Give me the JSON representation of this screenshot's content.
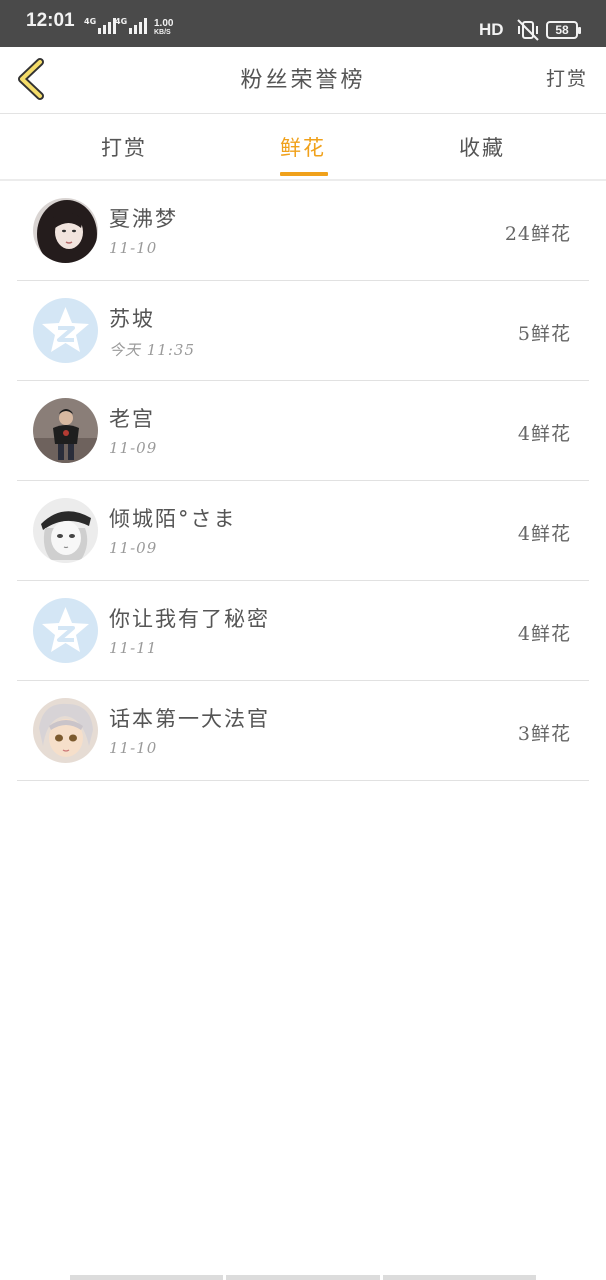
{
  "status_bar": {
    "time": "12:01",
    "net1_label": "4G",
    "net2_label": "4G",
    "speed_value": "1.00",
    "speed_unit": "KB/S",
    "hd_label": "HD",
    "battery": "58",
    "icons": [
      "signal-icon",
      "vibrate-mute-icon",
      "battery-icon"
    ]
  },
  "header": {
    "title": "粉丝荣誉榜",
    "action": "打赏",
    "back_icon": "chevron-left-icon"
  },
  "tabs": [
    {
      "label": "打赏",
      "active": false
    },
    {
      "label": "鲜花",
      "active": true
    },
    {
      "label": "收藏",
      "active": false
    }
  ],
  "accent_color": "#f0a11b",
  "fans": [
    {
      "name": "夏沸梦",
      "date": "11-10",
      "count": "24鲜花",
      "avatar": "photo-avatar"
    },
    {
      "name": "苏坡",
      "date": "今天 11:35",
      "count": "5鲜花",
      "avatar": "default-qzone-avatar"
    },
    {
      "name": "老宫",
      "date": "11-09",
      "count": "4鲜花",
      "avatar": "photo-avatar"
    },
    {
      "name": "倾城陌°さま",
      "date": "11-09",
      "count": "4鲜花",
      "avatar": "anime-avatar"
    },
    {
      "name": "你让我有了秘密",
      "date": "11-11",
      "count": "4鲜花",
      "avatar": "default-qzone-avatar"
    },
    {
      "name": "话本第一大法官",
      "date": "11-10",
      "count": "3鲜花",
      "avatar": "anime-avatar"
    }
  ]
}
